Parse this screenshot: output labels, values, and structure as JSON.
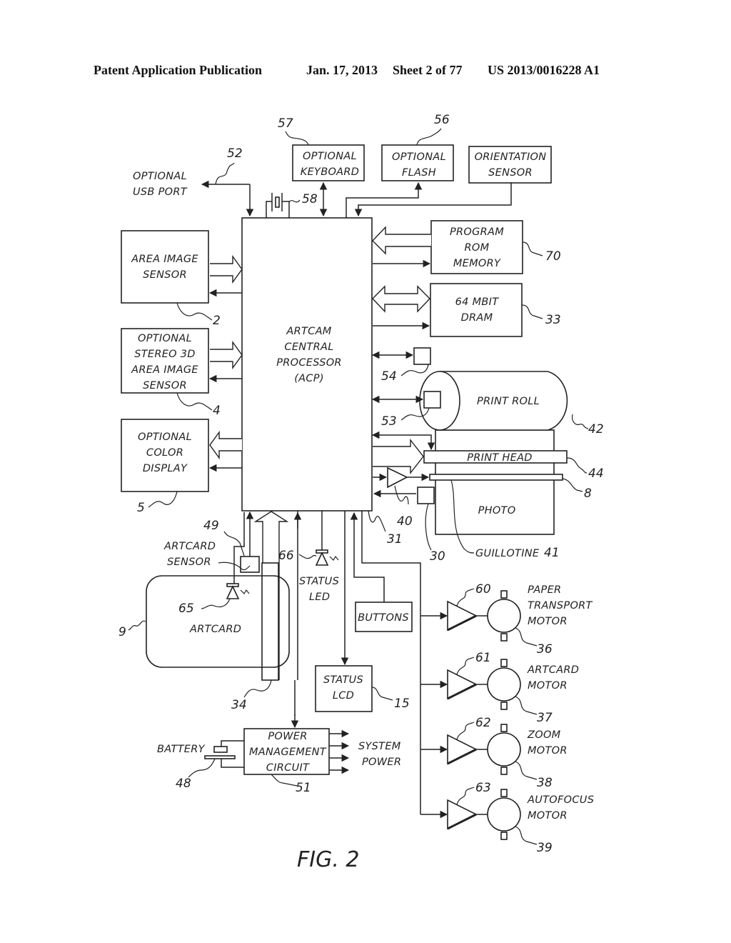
{
  "header": {
    "publication": "Patent Application Publication",
    "date": "Jan. 17, 2013",
    "sheet": "Sheet 2 of 77",
    "number": "US 2013/0016228 A1"
  },
  "figure": {
    "caption": "FIG. 2",
    "blocks": {
      "acp": [
        "ARTCAM",
        "CENTRAL",
        "PROCESSOR",
        "(ACP)"
      ],
      "area_image_sensor": [
        "AREA IMAGE",
        "SENSOR"
      ],
      "stereo_sensor": [
        "OPTIONAL",
        "STEREO 3D",
        "AREA IMAGE",
        "SENSOR"
      ],
      "color_display": [
        "OPTIONAL",
        "COLOR",
        "DISPLAY"
      ],
      "keyboard": [
        "OPTIONAL",
        "KEYBOARD"
      ],
      "flash": [
        "OPTIONAL",
        "FLASH"
      ],
      "orientation": [
        "ORIENTATION",
        "SENSOR"
      ],
      "rom": [
        "PROGRAM",
        "ROM",
        "MEMORY"
      ],
      "dram": [
        "64 MBIT",
        "DRAM"
      ],
      "print_roll": "PRINT ROLL",
      "print_head": "PRINT HEAD",
      "photo": "PHOTO",
      "guillotine": "GUILLOTINE",
      "usb": [
        "OPTIONAL",
        "USB PORT"
      ],
      "artcard_sensor": [
        "ARTCARD",
        "SENSOR"
      ],
      "artcard": "ARTCARD",
      "status_led": [
        "STATUS",
        "LED"
      ],
      "buttons": "BUTTONS",
      "status_lcd": [
        "STATUS",
        "LCD"
      ],
      "battery": "BATTERY",
      "power_mgmt": [
        "POWER",
        "MANAGEMENT",
        "CIRCUIT"
      ],
      "system_power": [
        "SYSTEM",
        "POWER"
      ],
      "motors": [
        {
          "label": [
            "PAPER",
            "TRANSPORT",
            "MOTOR"
          ],
          "driver_ref": "60",
          "motor_ref": "36"
        },
        {
          "label": [
            "ARTCARD",
            "MOTOR"
          ],
          "driver_ref": "61",
          "motor_ref": "37"
        },
        {
          "label": [
            "ZOOM",
            "MOTOR"
          ],
          "driver_ref": "62",
          "motor_ref": "38"
        },
        {
          "label": [
            "AUTOFOCUS",
            "MOTOR"
          ],
          "driver_ref": "63",
          "motor_ref": "39"
        }
      ]
    },
    "refs": {
      "usb": "52",
      "keyboard": "57",
      "flash": "56",
      "crystal": "58",
      "rom": "70",
      "dram": "33",
      "area_sensor": "2",
      "stereo": "4",
      "display": "5",
      "chip54": "54",
      "chip53": "53",
      "print_roll": "42",
      "print_head": "44",
      "guillotine_bar": "8",
      "amp": "40",
      "chip30": "30",
      "acp": "31",
      "guillotine": "41",
      "artcard_sensor": "49",
      "led66": "66",
      "led65": "65",
      "artcard": "9",
      "slot": "34",
      "lcd": "15",
      "battery": "48",
      "power": "51"
    }
  }
}
